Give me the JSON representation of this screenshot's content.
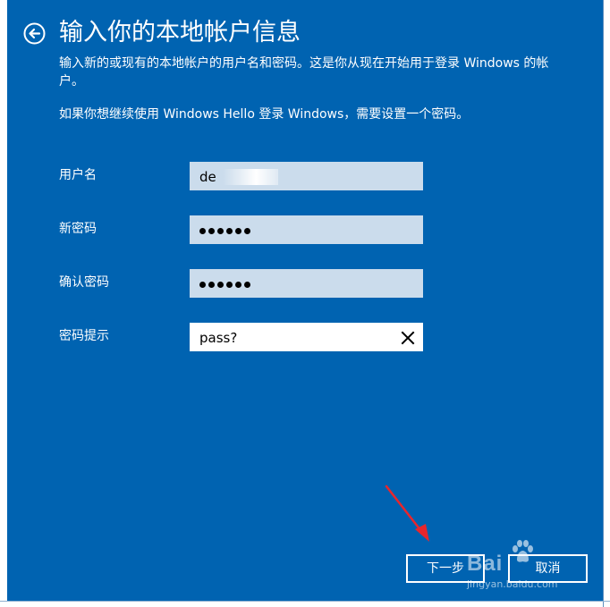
{
  "window": {
    "title": "输入你的本地帐户信息"
  },
  "description": {
    "line1": "输入新的或现有的本地帐户的用户名和密码。这是你从现在开始用于登录 Windows 的帐户。",
    "hello_note": "如果你想继续使用 Windows Hello 登录 Windows，需要设置一个密码。"
  },
  "form": {
    "username": {
      "label": "用户名",
      "value": "de"
    },
    "new_password": {
      "label": "新密码",
      "masked_length": 6
    },
    "confirm_password": {
      "label": "确认密码",
      "masked_length": 6
    },
    "password_hint": {
      "label": "密码提示",
      "value": "pass?"
    }
  },
  "buttons": {
    "next": "下一步",
    "cancel": "取消"
  },
  "icons": {
    "back": "back-arrow-circle-icon",
    "clear": "close-icon"
  },
  "annotation": {
    "arrow_color": "#e8262c"
  },
  "watermark": {
    "brand": "Bai",
    "url": "jingyan.baidu.com"
  },
  "colors": {
    "background": "#0063b1",
    "field_inactive": "#cbdcec",
    "field_active": "#ffffff",
    "text": "#ffffff"
  }
}
